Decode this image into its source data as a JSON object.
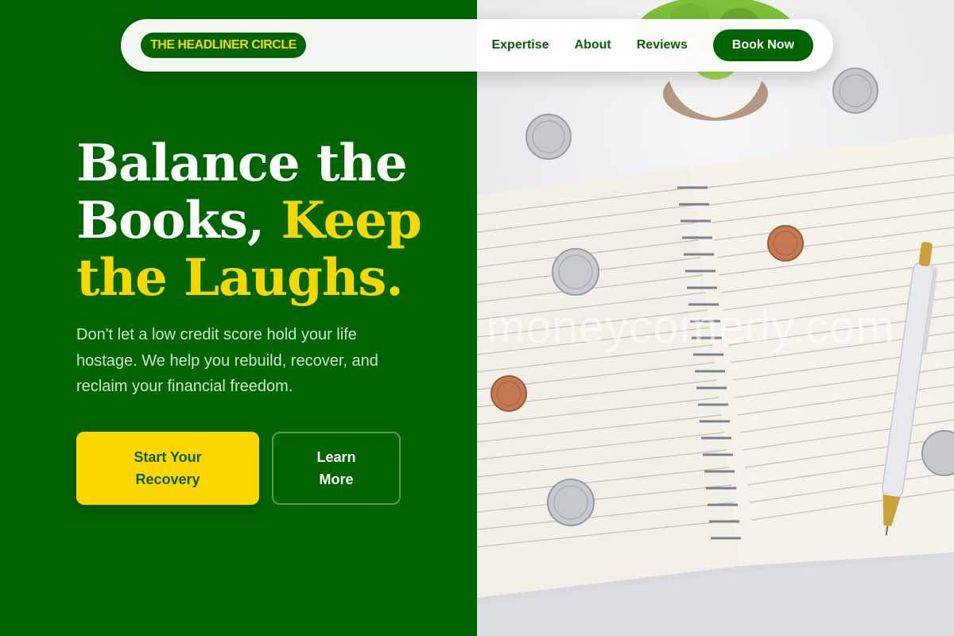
{
  "brand": {
    "name": "THE HEADLINER CIRCLE"
  },
  "nav": {
    "links": [
      "Expertise",
      "About",
      "Reviews"
    ],
    "cta": "Book Now"
  },
  "hero": {
    "title_line1": "Balance the",
    "title_line2": "Books, ",
    "title_accent_a": "Keep",
    "title_accent_b": "the Laughs.",
    "subtitle": "Don't let a low credit score hold your life hostage. We help you rebuild, recover, and reclaim your financial freedom.",
    "primary_cta": "Start Your Recovery",
    "secondary_cta": "Learn More"
  },
  "image": {
    "watermark": "moneycomedy.com",
    "subject": "notebook-coins-pen-plant"
  },
  "colors": {
    "brand_green": "#006400",
    "accent_yellow": "#ffd700",
    "nav_text": "#0b5d0b"
  }
}
